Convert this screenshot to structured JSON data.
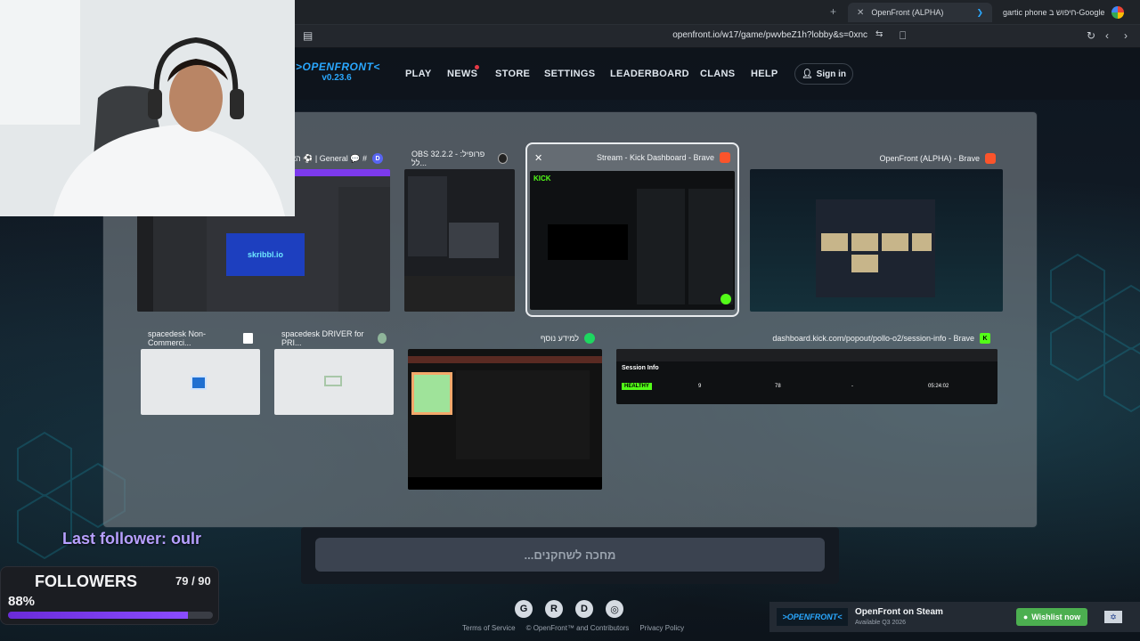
{
  "browser": {
    "tabs": [
      {
        "label": "OpenFront (ALPHA)",
        "active": true
      },
      {
        "label": "gartic phone חיפוש ב-Google",
        "active": false
      }
    ],
    "url": "openfront.io/w17/game/pwvbeZ1h?lobby&s=0xnc"
  },
  "site": {
    "logo_text": ">OPENFRONT<",
    "version": "v0.23.6",
    "nav": [
      "PLAY",
      "NEWS",
      "STORE",
      "SETTINGS",
      "LEADERBOARD",
      "CLANS",
      "HELP"
    ],
    "sign_in": "Sign in",
    "waiting_button": "...מחכה לשחקנים",
    "footer_links": [
      "Terms of Service",
      "© OpenFront™ and Contributors",
      "Privacy Policy"
    ],
    "footer_icons": [
      "github-icon",
      "reddit-icon",
      "discord-icon",
      "globe-icon"
    ],
    "steam": {
      "logo": ">OPENFRONT<",
      "title": "OpenFront on Steam",
      "subtitle": "Available Q3 2026",
      "wishlist": "Wishlist now"
    }
  },
  "switcher": {
    "windows": [
      {
        "title": "האסם ⚽ | General 💬 #",
        "icon": "discord-icon"
      },
      {
        "title": "OBS 32.2.2 - פרופיל: לל...",
        "icon": "obs-icon"
      },
      {
        "title": "Stream - Kick Dashboard - Brave",
        "icon": "brave-icon",
        "selected": true
      },
      {
        "title": "OpenFront (ALPHA) - Brave",
        "icon": "brave-icon"
      },
      {
        "title": "spacedesk Non-Commerci...",
        "icon": "spacedesk-icon"
      },
      {
        "title": "spacedesk DRIVER for PRI...",
        "icon": "spacedesk-icon"
      },
      {
        "title": "למידע נוסף",
        "icon": "spotify-icon"
      },
      {
        "title": "dashboard.kick.com/popout/pollo-o2/session-info - Brave",
        "icon": "kick-icon"
      }
    ],
    "kick_session": {
      "header": "Session Info",
      "status": "HEALTHY",
      "values": [
        "9",
        "78",
        "-",
        "05:24:02"
      ]
    }
  },
  "overlay": {
    "last_follower": "Last follower: oulr",
    "followers_label": "FOLLOWERS",
    "followers_count": "79 / 90",
    "followers_percent": "88%",
    "progress": 0.88
  },
  "colors": {
    "accent_blue": "#2aa8ff",
    "kick_green": "#53fc18",
    "follower_purple": "#7b3cf0"
  }
}
